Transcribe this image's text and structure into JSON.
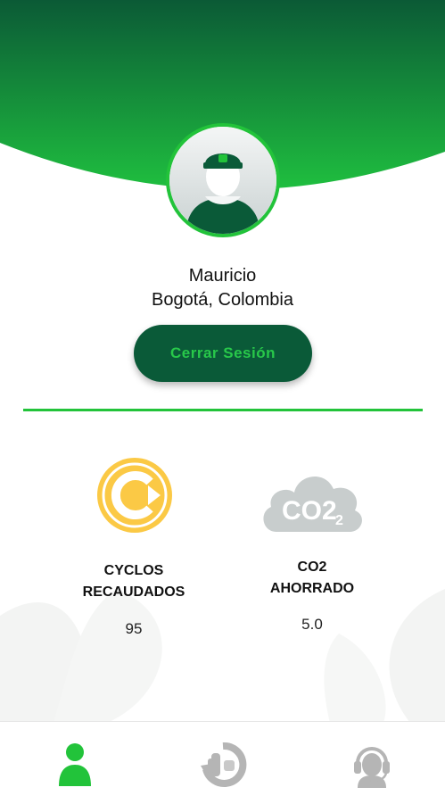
{
  "profile": {
    "name": "Mauricio",
    "location": "Bogotá, Colombia",
    "avatar_icon": "user-cap-avatar"
  },
  "actions": {
    "logout_label": "Cerrar Sesión"
  },
  "stats": [
    {
      "icon": "cyclos-coin-icon",
      "title": "CYCLOS\nRECAUDADOS",
      "value": "95"
    },
    {
      "icon": "co2-cloud-icon",
      "icon_text": "CO2",
      "title": "CO2\nAHORRADO",
      "value": "5.0"
    }
  ],
  "nav": [
    {
      "icon": "profile-icon",
      "active": true
    },
    {
      "icon": "recycle-hand-icon",
      "active": false
    },
    {
      "icon": "support-headset-icon",
      "active": false
    }
  ],
  "colors": {
    "header_dark": "#0b5a36",
    "header_light": "#20c241",
    "accent_green": "#22c33a",
    "button_bg": "#0a5a38",
    "coin_yellow": "#fbc945",
    "cloud_gray": "#c8cdcd",
    "nav_inactive": "#b5b5b5"
  }
}
